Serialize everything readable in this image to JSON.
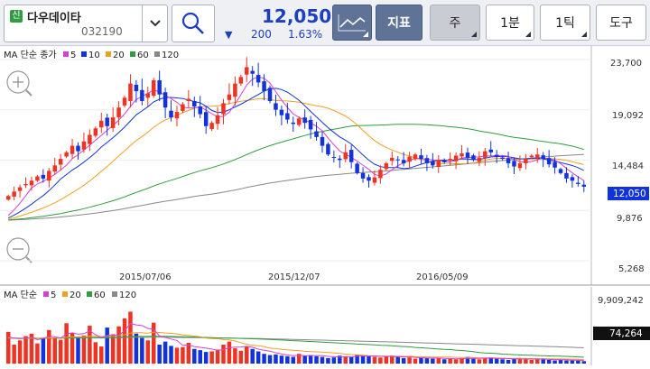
{
  "stock": {
    "badge": "신",
    "name": "다우데이타",
    "code": "032190"
  },
  "quote": {
    "price": "12,050",
    "arrow": "▼",
    "change": "200",
    "change_pct": "1.63%"
  },
  "toolbar": {
    "indicator_label": "지표",
    "week_label": "주",
    "minute_label": "1분",
    "tick_label": "1틱",
    "tools_label": "도구"
  },
  "icons": {
    "search": "search-icon",
    "dropdown": "chevron-down-icon",
    "line_chart": "line-chart-icon",
    "zoom_in": "zoom-in-icon",
    "zoom_out": "zoom-out-icon"
  },
  "colors": {
    "up": "#ee3322",
    "down": "#1133dd",
    "ma5": "#d63fd6",
    "ma10": "#1133dd",
    "ma20": "#f0a020",
    "ma60": "#2e9c3f",
    "ma120": "#888888"
  },
  "price_panel": {
    "legend": {
      "title": "MA 단순 종가",
      "items": [
        {
          "label": "5",
          "color": "#d63fd6"
        },
        {
          "label": "10",
          "color": "#1133dd"
        },
        {
          "label": "20",
          "color": "#f0a020"
        },
        {
          "label": "60",
          "color": "#2e9c3f"
        },
        {
          "label": "120",
          "color": "#888888"
        }
      ]
    },
    "y_labels": [
      "23,700",
      "19,092",
      "14,484",
      "9,876",
      "5,268"
    ],
    "current_price_tag": "12,050"
  },
  "volume_panel": {
    "legend": {
      "title": "MA 단순",
      "items": [
        {
          "label": "5",
          "color": "#d63fd6"
        },
        {
          "label": "20",
          "color": "#f0a020"
        },
        {
          "label": "60",
          "color": "#2e9c3f"
        },
        {
          "label": "120",
          "color": "#888888"
        }
      ]
    },
    "y_label_top": "9,909,242",
    "current_volume_tag": "74,264"
  },
  "x_labels": [
    "2015/07/06",
    "2015/12/07",
    "2016/05/09"
  ],
  "chart_data": {
    "type": "candlestick",
    "ylim": [
      5268,
      23700
    ],
    "closes": [
      11200,
      11600,
      12000,
      12300,
      12600,
      13000,
      12800,
      13500,
      14000,
      14600,
      15200,
      15800,
      15300,
      16200,
      16800,
      17400,
      18100,
      17600,
      18400,
      19300,
      20200,
      21500,
      20800,
      19900,
      20600,
      21800,
      20500,
      19300,
      18400,
      18900,
      19600,
      20100,
      19400,
      18700,
      17600,
      17900,
      18600,
      19700,
      20500,
      21500,
      22100,
      23000,
      22400,
      21600,
      20800,
      19900,
      19100,
      18600,
      18200,
      17800,
      18300,
      17900,
      17300,
      16600,
      15800,
      15000,
      14700,
      14500,
      15200,
      14300,
      13300,
      12800,
      12600,
      12900,
      13600,
      14200,
      14700,
      14500,
      14200,
      14800,
      15000,
      14600,
      14200,
      14000,
      14500,
      14300,
      14600,
      14900,
      15100,
      14700,
      14500,
      14700,
      15300,
      15200,
      14800,
      14600,
      14200,
      13900,
      14200,
      14600,
      14900,
      15000,
      14600,
      14100,
      13800,
      13300,
      12800,
      12600,
      12300,
      12050
    ],
    "volumes": [
      5.2,
      3.1,
      3.8,
      4.5,
      4.9,
      3.3,
      4.1,
      5.5,
      4.2,
      3.9,
      6.6,
      5.0,
      4.4,
      4.6,
      6.2,
      3.5,
      2.8,
      5.9,
      4.8,
      6.1,
      7.4,
      8.5,
      4.9,
      4.2,
      3.8,
      6.7,
      3.1,
      3.6,
      2.9,
      2.6,
      2.7,
      3.4,
      2.4,
      2.2,
      1.9,
      2.0,
      2.3,
      3.1,
      3.6,
      2.5,
      2.1,
      2.8,
      2.4,
      2.0,
      1.6,
      1.4,
      1.5,
      1.3,
      1.2,
      1.1,
      1.6,
      1.3,
      1.4,
      1.2,
      1.1,
      0.9,
      1.0,
      1.3,
      1.2,
      1.1,
      1.4,
      1.3,
      1.2,
      1.1,
      1.0,
      1.2,
      1.3,
      1.1,
      0.9,
      1.0,
      0.8,
      1.0,
      0.9,
      0.8,
      0.9,
      0.7,
      0.8,
      0.7,
      0.9,
      1.1,
      0.8,
      0.7,
      0.9,
      1.0,
      0.8,
      0.7,
      0.6,
      0.8,
      0.9,
      0.7,
      0.6,
      0.7,
      0.8,
      0.6,
      0.5,
      0.6,
      0.5,
      0.6,
      0.5,
      0.4
    ]
  }
}
